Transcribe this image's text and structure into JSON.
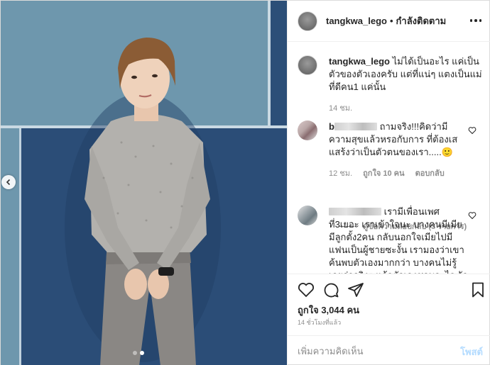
{
  "post": {
    "username": "tangkwa_lego",
    "separator": "•",
    "follow_status": "กำลังติดตาม"
  },
  "caption": {
    "username": "tangkwa_lego",
    "text": "ไม่ได้เป็นอะไร แค่เป็นตัวของตัวเองครับ แต่ที่แน่ๆ แตงเป็นแม่ที่ดีคน1 แค่นั้น",
    "time": "14 ชม."
  },
  "comments": [
    {
      "username_visible": "b",
      "text": "ถามจริง!!!คิดว่ามีความสุขแล้วหรอกับการ ที่ต้องเสแสร้งว่าเป็นตัวตนของเรา.....🙂",
      "time": "12 ชม.",
      "likes": "ถูกใจ 10 คน",
      "reply_label": "ตอบกลับ",
      "view_replies": "ดูข้อความตอบกลับ (3 รายการ)"
    },
    {
      "username_visible": "",
      "text": "เรามีเพื่อนเพศที่3เยอะ เราเข้าใจนะ บางคนมีเมีย มีลูกตั้ง2คน กลับนอกใจเมียไปมีแฟนเป็นผู้ชายซะงั้น เรามองว่าเขาค้นพบตัวเองมากกว่า บางคนไม่รู้เลยว่าจริงๆ แล้วตัวเองชอบอะไร รักอะไร เมื่อค้น"
    }
  ],
  "actions": {
    "like_icon": "heart-icon",
    "comment_icon": "comment-icon",
    "share_icon": "paper-plane-icon",
    "save_icon": "bookmark-icon",
    "likes_count": "ถูกใจ 3,044 คน",
    "timestamp": "14 ชั่วโมงที่แล้ว"
  },
  "add_comment": {
    "placeholder": "เพิ่มความคิดเห็น",
    "post_label": "โพสต์"
  },
  "carousel": {
    "prev_icon": "chevron-left-icon",
    "current_slide": 2,
    "total_slides": 2
  },
  "colors": {
    "link_disabled": "#b3dbff",
    "muted_text": "#8e8e8e",
    "border": "#efefef"
  }
}
